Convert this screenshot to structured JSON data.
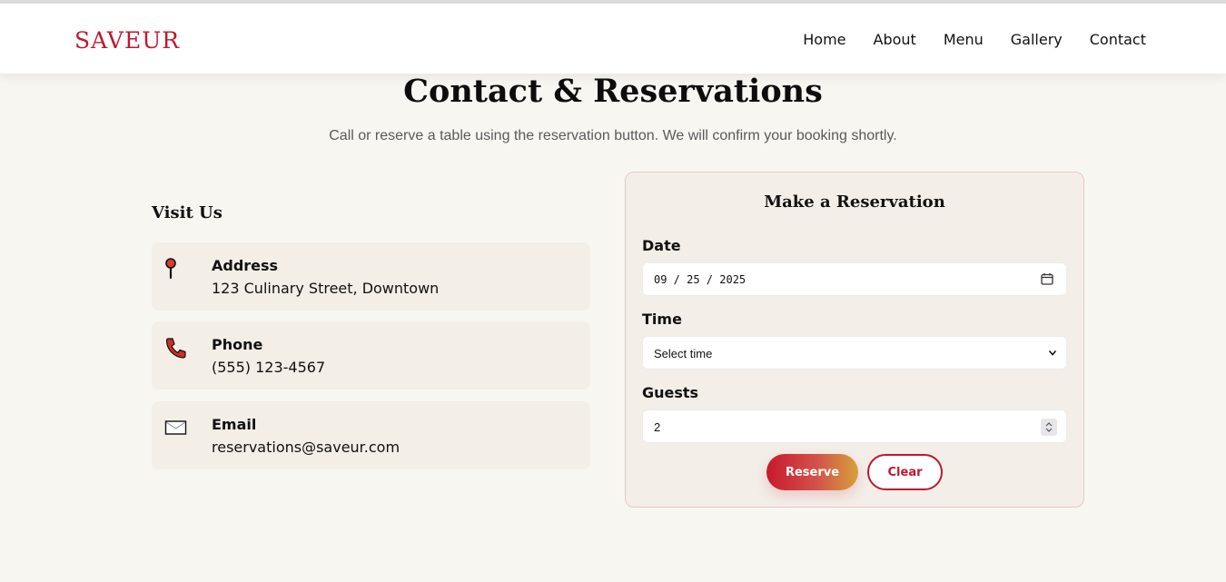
{
  "header": {
    "logo": "SAVEUR",
    "nav": [
      "Home",
      "About",
      "Menu",
      "Gallery",
      "Contact"
    ]
  },
  "hero": {
    "title": "Contact & Reservations",
    "subtitle": "Call or reserve a table using the reservation button. We will confirm your booking shortly."
  },
  "visit": {
    "title": "Visit Us",
    "cards": [
      {
        "icon": "map-pin-icon",
        "label": "Address",
        "value": "123 Culinary Street, Downtown"
      },
      {
        "icon": "phone-icon",
        "label": "Phone",
        "value": "(555) 123-4567"
      },
      {
        "icon": "envelope-icon",
        "label": "Email",
        "value": "reservations@saveur.com"
      }
    ]
  },
  "reservation": {
    "title": "Make a Reservation",
    "date_label": "Date",
    "date_value": "09 / 25 / 2025",
    "time_label": "Time",
    "time_value": "Select time",
    "guests_label": "Guests",
    "guests_value": "2",
    "reserve_label": "Reserve",
    "clear_label": "Clear"
  },
  "colors": {
    "brand": "#c0182f",
    "background": "#f8f6f1",
    "card": "#f3eee6",
    "gradient_end": "#d6a03c"
  }
}
